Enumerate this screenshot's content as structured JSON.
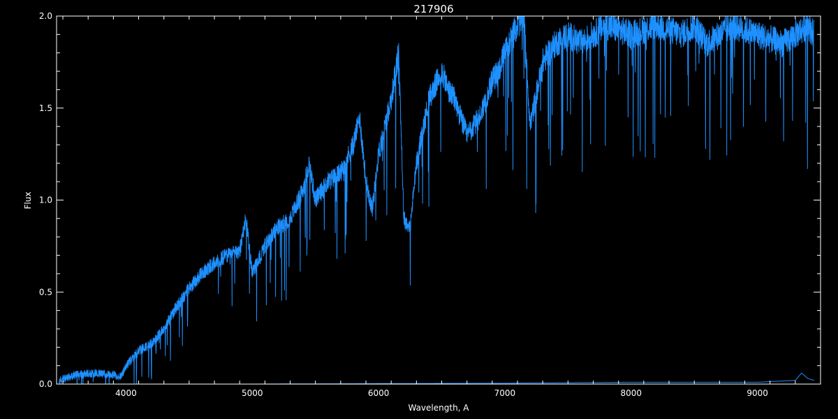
{
  "chart_data": {
    "type": "line",
    "title": "217906",
    "xlabel": "Wavelength, A",
    "ylabel": "Flux",
    "xlim": [
      3450,
      9500
    ],
    "ylim": [
      0,
      2.0
    ],
    "x_ticks": [
      4000,
      5000,
      6000,
      7000,
      8000,
      9000
    ],
    "x_tick_labels": [
      "4000",
      "5000",
      "6000",
      "7000",
      "8000",
      "9000"
    ],
    "y_ticks": [
      0,
      0.5,
      1.0,
      1.5,
      2.0
    ],
    "y_tick_labels": [
      "0.0",
      "0.5",
      "1.0",
      "1.5",
      "2.0"
    ],
    "grid": false,
    "colors": {
      "background": "#000000",
      "axes": "#ffffff",
      "spectrum": "#1e90ff",
      "model": "#ffffff"
    },
    "series": [
      {
        "role": "spectrum",
        "color": "#1e90ff",
        "x": [
          3470,
          3600,
          3750,
          3900,
          3960,
          4000,
          4100,
          4200,
          4300,
          4400,
          4500,
          4600,
          4700,
          4800,
          4900,
          4950,
          5000,
          5100,
          5200,
          5300,
          5400,
          5450,
          5500,
          5600,
          5700,
          5800,
          5850,
          5900,
          5950,
          6000,
          6100,
          6160,
          6200,
          6250,
          6300,
          6400,
          6500,
          6550,
          6600,
          6700,
          6750,
          6800,
          6900,
          6950,
          7000,
          7100,
          7150,
          7200,
          7300,
          7400,
          7500,
          7600,
          7700,
          7800,
          8000,
          8200,
          8400,
          8500,
          8600,
          8800,
          9000,
          9200,
          9300,
          9400,
          9450
        ],
        "y": [
          0.02,
          0.05,
          0.06,
          0.05,
          0.04,
          0.1,
          0.18,
          0.22,
          0.3,
          0.42,
          0.52,
          0.6,
          0.66,
          0.7,
          0.72,
          0.9,
          0.6,
          0.75,
          0.85,
          0.9,
          1.05,
          1.2,
          1.0,
          1.1,
          1.15,
          1.3,
          1.45,
          1.1,
          0.95,
          1.25,
          1.55,
          1.8,
          0.9,
          0.85,
          1.2,
          1.55,
          1.7,
          1.6,
          1.55,
          1.35,
          1.4,
          1.45,
          1.65,
          1.7,
          1.8,
          1.95,
          2.0,
          1.4,
          1.75,
          1.85,
          1.9,
          1.85,
          1.9,
          1.95,
          1.9,
          1.95,
          1.9,
          1.95,
          1.85,
          1.95,
          1.9,
          1.85,
          1.9,
          1.95,
          1.9
        ]
      },
      {
        "role": "baseline",
        "color": "#1e90ff",
        "x": [
          3470,
          5000,
          7000,
          8000,
          9000,
          9300,
          9350,
          9400,
          9450
        ],
        "y": [
          0.0,
          0.0,
          0.005,
          0.01,
          0.01,
          0.02,
          0.06,
          0.03,
          0.02
        ]
      }
    ]
  }
}
